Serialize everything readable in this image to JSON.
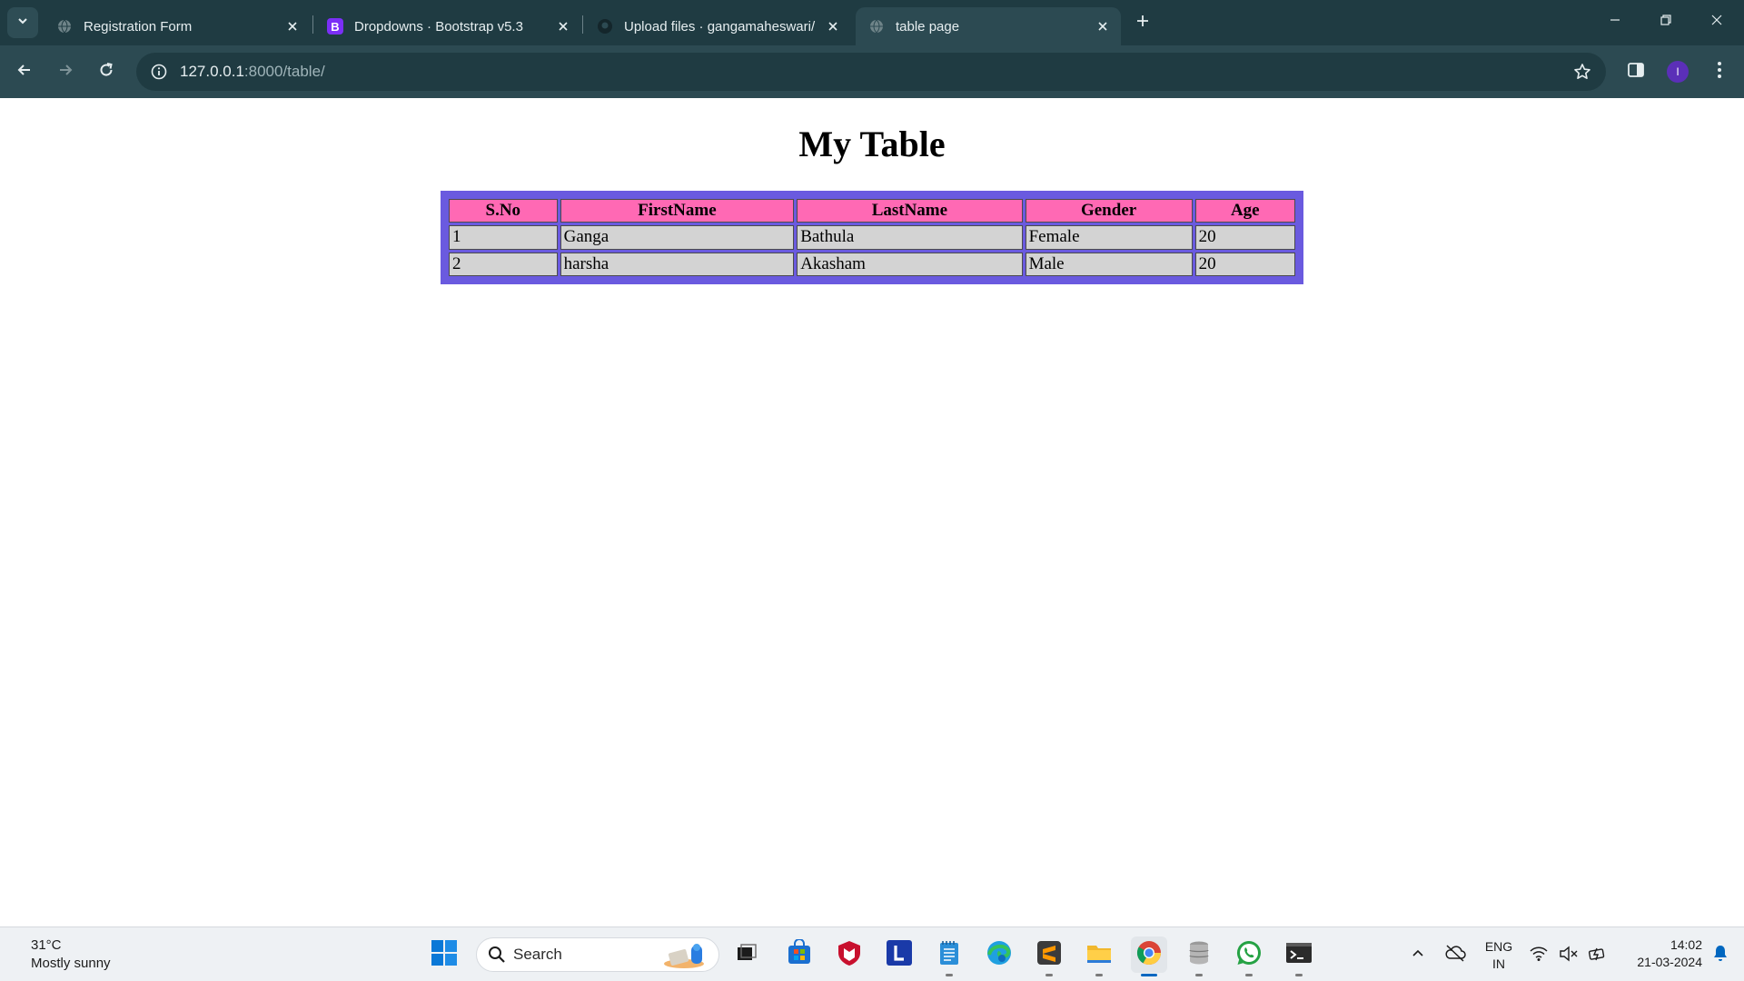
{
  "browser": {
    "tabs": [
      {
        "title": "Registration Form",
        "favicon": "globe-icon",
        "active": false
      },
      {
        "title": "Dropdowns · Bootstrap v5.3",
        "favicon": "bootstrap-icon",
        "active": false
      },
      {
        "title": "Upload files · gangamaheswari/",
        "favicon": "github-icon",
        "active": false
      },
      {
        "title": "table page",
        "favicon": "globe-icon",
        "active": true
      }
    ],
    "url_host": "127.0.0.1",
    "url_path": ":8000/table/",
    "profile_initial": "I"
  },
  "page": {
    "title": "My Table",
    "table": {
      "headers": [
        "S.No",
        "FirstName",
        "LastName",
        "Gender",
        "Age"
      ],
      "rows": [
        [
          "1",
          "Ganga",
          "Bathula",
          "Female",
          "20"
        ],
        [
          "2",
          "harsha",
          "Akasham",
          "Male",
          "20"
        ]
      ]
    }
  },
  "taskbar": {
    "weather_temp": "31°C",
    "weather_desc": "Mostly sunny",
    "search_placeholder": "Search",
    "language_top": "ENG",
    "language_bottom": "IN",
    "time": "14:02",
    "date": "21-03-2024"
  },
  "colors": {
    "table_border": "#6a5adf",
    "header_bg": "#ff69b4",
    "cell_bg": "#d3d3d3",
    "browser_frame": "#1f3b42",
    "browser_toolbar": "#2c4a52"
  }
}
